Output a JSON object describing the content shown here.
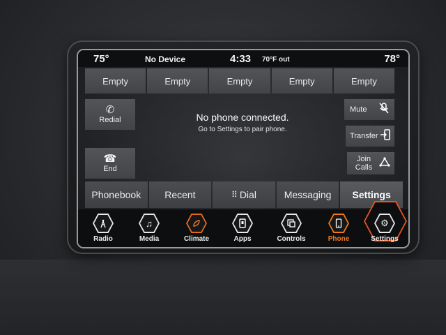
{
  "status": {
    "left_temp": "75°",
    "device": "No Device",
    "time": "4:33",
    "outside_temp": "70°F out",
    "right_temp": "78°"
  },
  "favorites": [
    "Empty",
    "Empty",
    "Empty",
    "Empty",
    "Empty"
  ],
  "left_buttons": {
    "redial": "Redial",
    "end": "End"
  },
  "right_buttons": {
    "mute": "Mute",
    "transfer": "Transfer",
    "join_line1": "Join",
    "join_line2": "Calls"
  },
  "message": {
    "title": "No phone connected.",
    "subtitle": "Go to Settings to pair phone."
  },
  "tabs": {
    "phonebook": "Phonebook",
    "recent": "Recent",
    "dial": "Dial",
    "messaging": "Messaging",
    "settings": "Settings"
  },
  "nav": {
    "radio": "Radio",
    "media": "Media",
    "climate": "Climate",
    "apps": "Apps",
    "controls": "Controls",
    "phone": "Phone",
    "settings": "Settings"
  },
  "icons": {
    "phone_handset": "☎",
    "music": "♫",
    "gear": "⚙"
  },
  "colors": {
    "accent_orange": "#f07a1c",
    "highlight_red": "#e9541e"
  }
}
